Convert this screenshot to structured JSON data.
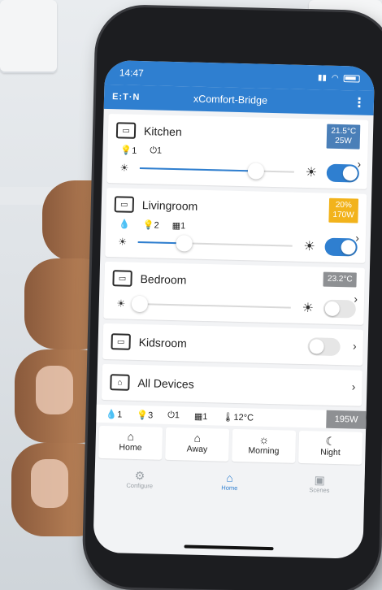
{
  "status": {
    "time": "14:47"
  },
  "app": {
    "logo": "E:T·N",
    "title": "xComfort-Bridge",
    "menu_icon": "kebab-menu-icon"
  },
  "rooms": [
    {
      "name": "Kitchen",
      "badge_line1": "21.5°C",
      "badge_line2": "25W",
      "badge_color": "#4a7fb8",
      "meta": [
        {
          "icon": "bulb-icon",
          "value": "1"
        },
        {
          "icon": "power-icon",
          "value": "1"
        }
      ],
      "slider": 0.75,
      "toggle": true
    },
    {
      "name": "Livingroom",
      "badge_line1": "20%",
      "badge_line2": "170W",
      "badge_color": "#f2b31c",
      "meta": [
        {
          "icon": "drop-icon",
          "value": ""
        },
        {
          "icon": "bulb-icon",
          "value": "2"
        },
        {
          "icon": "shutter-icon",
          "value": "1"
        }
      ],
      "slider": 0.3,
      "toggle": true
    },
    {
      "name": "Bedroom",
      "badge_line1": "23.2°C",
      "badge_line2": "",
      "badge_color": "#8e9093",
      "meta": [],
      "slider": 0.02,
      "toggle": false
    },
    {
      "name": "Kidsroom",
      "toggle": false
    },
    {
      "name": "All Devices"
    }
  ],
  "summary": {
    "drop": "1",
    "bulb": "3",
    "power": "1",
    "shutter": "1",
    "temp": "12°C",
    "watt": "195W"
  },
  "scenes": [
    {
      "label": "Home",
      "icon": "house-icon"
    },
    {
      "label": "Away",
      "icon": "house-away-icon"
    },
    {
      "label": "Morning",
      "icon": "sunrise-icon"
    },
    {
      "label": "Night",
      "icon": "moon-icon"
    }
  ],
  "tabs": [
    {
      "label": "Configure",
      "icon": "gear-icon",
      "active": false
    },
    {
      "label": "Home",
      "icon": "home-icon",
      "active": true
    },
    {
      "label": "Scenes",
      "icon": "scenes-icon",
      "active": false
    }
  ]
}
